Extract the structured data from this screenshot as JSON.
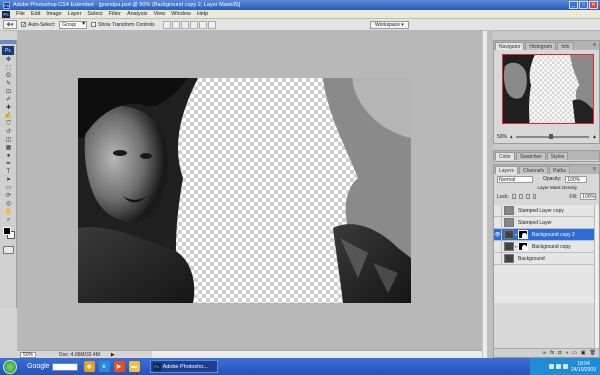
{
  "window": {
    "title": "Adobe Photoshop CS4 Extended - [grandpa.psd @ 50% (Background copy 2, Layer Mask/8)]",
    "controls": [
      "_",
      "□",
      "✕"
    ]
  },
  "app_badge": "Ps",
  "menu": [
    "File",
    "Edit",
    "Image",
    "Layer",
    "Select",
    "Filter",
    "Analysis",
    "View",
    "Window",
    "Help"
  ],
  "options": {
    "auto_select_label": "Auto-Select:",
    "auto_select_value": "Group",
    "transform_label": "Show Transform Controls",
    "workspace": "Workspace"
  },
  "toolbox": {
    "badge": "Ps",
    "tools": [
      "move-icon",
      "marquee-icon",
      "lasso-icon",
      "quick-select-icon",
      "crop-icon",
      "eyedropper-icon",
      "healing-icon",
      "brush-icon",
      "clone-stamp-icon",
      "history-brush-icon",
      "eraser-icon",
      "gradient-icon",
      "dodge-icon",
      "pen-icon",
      "type-icon",
      "path-select-icon",
      "shape-icon",
      "3d-rotate-icon",
      "3d-orbit-icon",
      "hand-icon",
      "zoom-icon"
    ],
    "glyphs": [
      "✥",
      "⬚",
      "ʘ",
      "✎",
      "⊡",
      "✐",
      "✚",
      "✍",
      "⛉",
      "↺",
      "◫",
      "▦",
      "●",
      "✒",
      "T",
      "➤",
      "▭",
      "⟳",
      "◎",
      "✋",
      "⌕"
    ]
  },
  "status": {
    "zoom": "50%",
    "doc": "Doc: 4.95M/32.4M"
  },
  "navigator": {
    "tabs": [
      "Navigator",
      "Histogram",
      "Info"
    ],
    "zoom": "50%"
  },
  "color_panel": {
    "tabs": [
      "Color",
      "Swatches",
      "Styles"
    ]
  },
  "layers_panel": {
    "tabs": [
      "Layers",
      "Channels",
      "Paths"
    ],
    "blend_mode": "Normal",
    "opacity_label": "Opacity:",
    "opacity": "100%",
    "density_label": "Layer Mask Density",
    "lock_label": "Lock:",
    "fill_label": "Fill:",
    "fill": "100%",
    "layers": [
      {
        "name": "Stamped Layer copy",
        "visible": false,
        "selected": false,
        "has_mask": false
      },
      {
        "name": "Stamped Layer",
        "visible": false,
        "selected": false,
        "has_mask": false
      },
      {
        "name": "Background copy 2",
        "visible": true,
        "selected": true,
        "has_mask": true
      },
      {
        "name": "Background copy",
        "visible": false,
        "selected": false,
        "has_mask": true
      },
      {
        "name": "Background",
        "visible": false,
        "selected": false,
        "has_mask": false
      }
    ],
    "footer_icons": [
      "link-icon",
      "fx-icon",
      "mask-icon",
      "adjustment-icon",
      "group-icon",
      "new-layer-icon",
      "trash-icon"
    ],
    "footer_glyphs": [
      "∞",
      "fx",
      "◘",
      "◑",
      "▭",
      "▣",
      "🗑"
    ]
  },
  "taskbar": {
    "search_label": "Google",
    "task_label": "Adobe Photosho...",
    "time": "18:04",
    "date": "24/10/2009"
  }
}
